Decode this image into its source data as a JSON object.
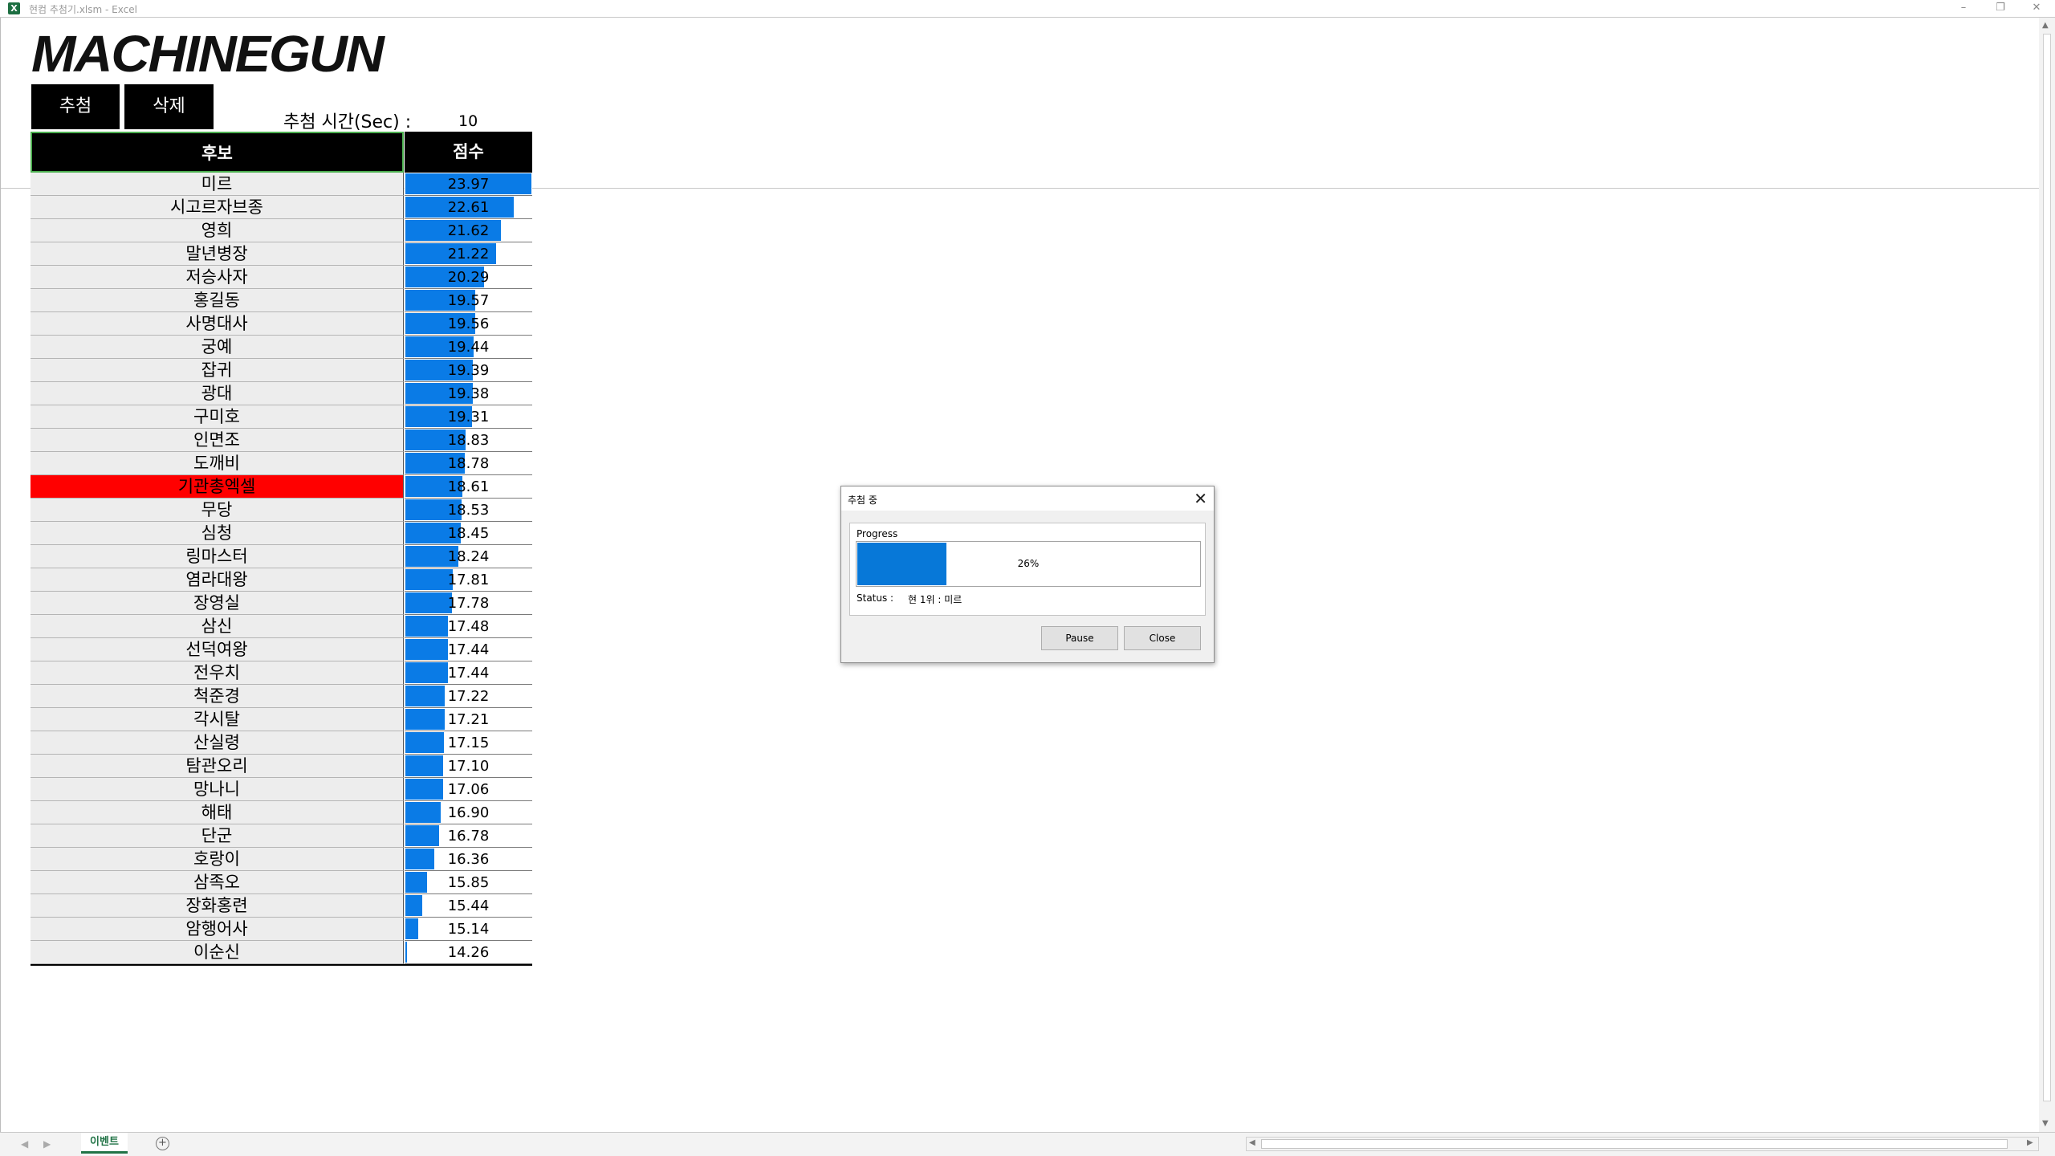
{
  "window": {
    "title": "현컴 추첨기.xlsm - Excel",
    "app_icon": "X"
  },
  "sheet": {
    "logo": "MACHINEGUN",
    "buttons": {
      "draw": "추첨",
      "delete": "삭제"
    },
    "time_label": "추첨 시간(Sec) :",
    "time_value": "10",
    "headers": {
      "name": "후보",
      "score": "점수"
    },
    "highlight_row": 13,
    "score_range": [
      14.26,
      23.97
    ],
    "rows": [
      {
        "name": "미르",
        "score": "23.97"
      },
      {
        "name": "시고르자브종",
        "score": "22.61"
      },
      {
        "name": "영희",
        "score": "21.62"
      },
      {
        "name": "말년병장",
        "score": "21.22"
      },
      {
        "name": "저승사자",
        "score": "20.29"
      },
      {
        "name": "홍길동",
        "score": "19.57"
      },
      {
        "name": "사명대사",
        "score": "19.56"
      },
      {
        "name": "궁예",
        "score": "19.44"
      },
      {
        "name": "잡귀",
        "score": "19.39"
      },
      {
        "name": "광대",
        "score": "19.38"
      },
      {
        "name": "구미호",
        "score": "19.31"
      },
      {
        "name": "인면조",
        "score": "18.83"
      },
      {
        "name": "도깨비",
        "score": "18.78"
      },
      {
        "name": "기관총엑셀",
        "score": "18.61"
      },
      {
        "name": "무당",
        "score": "18.53"
      },
      {
        "name": "심청",
        "score": "18.45"
      },
      {
        "name": "링마스터",
        "score": "18.24"
      },
      {
        "name": "염라대왕",
        "score": "17.81"
      },
      {
        "name": "장영실",
        "score": "17.78"
      },
      {
        "name": "삼신",
        "score": "17.48"
      },
      {
        "name": "선덕여왕",
        "score": "17.44"
      },
      {
        "name": "전우치",
        "score": "17.44"
      },
      {
        "name": "척준경",
        "score": "17.22"
      },
      {
        "name": "각시탈",
        "score": "17.21"
      },
      {
        "name": "산실령",
        "score": "17.15"
      },
      {
        "name": "탐관오리",
        "score": "17.10"
      },
      {
        "name": "망나니",
        "score": "17.06"
      },
      {
        "name": "해태",
        "score": "16.90"
      },
      {
        "name": "단군",
        "score": "16.78"
      },
      {
        "name": "호랑이",
        "score": "16.36"
      },
      {
        "name": "삼족오",
        "score": "15.85"
      },
      {
        "name": "장화홍련",
        "score": "15.44"
      },
      {
        "name": "암행어사",
        "score": "15.14"
      },
      {
        "name": "이순신",
        "score": "14.26"
      }
    ]
  },
  "dialog": {
    "title": "추첨 중",
    "group_label": "Progress",
    "progress_percent": 26,
    "progress_text": "26%",
    "status_label": "Status :",
    "status_value": "현 1위 : 미르",
    "pause_label": "Pause",
    "close_label": "Close"
  },
  "tabs": {
    "active": "이벤트"
  },
  "colors": {
    "bar": "#0a7be6",
    "highlight": "#ff0000",
    "excel_green": "#217346"
  }
}
